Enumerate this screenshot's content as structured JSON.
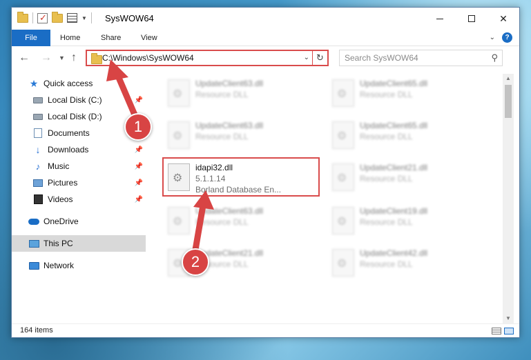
{
  "window": {
    "title": "SysWOW64",
    "minimize_glyph": "",
    "close_glyph": "✕"
  },
  "ribbon": {
    "tabs": [
      "File",
      "Home",
      "Share",
      "View"
    ]
  },
  "address": {
    "path": "C:\\Windows\\SysWOW64",
    "refresh_glyph": "↻"
  },
  "search": {
    "placeholder": "Search SysWOW64"
  },
  "nav_pane": {
    "items": [
      {
        "label": "Quick access",
        "icon": "star-icon"
      },
      {
        "label": "Local Disk (C:)",
        "icon": "drive-icon",
        "pinned": true
      },
      {
        "label": "Local Disk (D:)",
        "icon": "drive-icon"
      },
      {
        "label": "Documents",
        "icon": "documents-icon"
      },
      {
        "label": "Downloads",
        "icon": "download-icon",
        "pinned": true
      },
      {
        "label": "Music",
        "icon": "music-icon",
        "pinned": true
      },
      {
        "label": "Pictures",
        "icon": "pictures-icon",
        "pinned": true
      },
      {
        "label": "Videos",
        "icon": "videos-icon",
        "pinned": true
      },
      {
        "label": "OneDrive",
        "icon": "onedrive-icon"
      },
      {
        "label": "This PC",
        "icon": "pc-icon",
        "selected": true
      },
      {
        "label": "Network",
        "icon": "network-icon"
      }
    ]
  },
  "files": [
    {
      "name": "UpdateClient63.dll",
      "type": "Resource DLL",
      "blurred": true
    },
    {
      "name": "UpdateClient65.dll",
      "type": "Resource DLL",
      "blurred": true
    },
    {
      "name": "UpdateClient63.dll",
      "type": "Resource DLL",
      "blurred": true
    },
    {
      "name": "UpdateClient65.dll",
      "type": "Resource DLL",
      "blurred": true
    },
    {
      "name": "idapi32.dll",
      "version": "5.1.1.14",
      "description": "Borland Database En...",
      "blurred": false
    },
    {
      "name": "UpdateClient21.dll",
      "type": "Resource DLL",
      "blurred": true
    },
    {
      "name": "UpdateClient63.dll",
      "type": "Resource DLL",
      "blurred": true
    },
    {
      "name": "UpdateClient19.dll",
      "type": "Resource DLL",
      "blurred": true
    },
    {
      "name": "UpdateClient21.dll",
      "type": "Resource DLL",
      "blurred": true
    },
    {
      "name": "UpdateClient42.dll",
      "type": "Resource DLL",
      "blurred": true
    }
  ],
  "status": {
    "item_count": "164 items"
  },
  "annotations": {
    "badge1": "1",
    "badge2": "2"
  },
  "colors": {
    "accent": "#1a6dc5",
    "highlight": "#d94b4b"
  }
}
